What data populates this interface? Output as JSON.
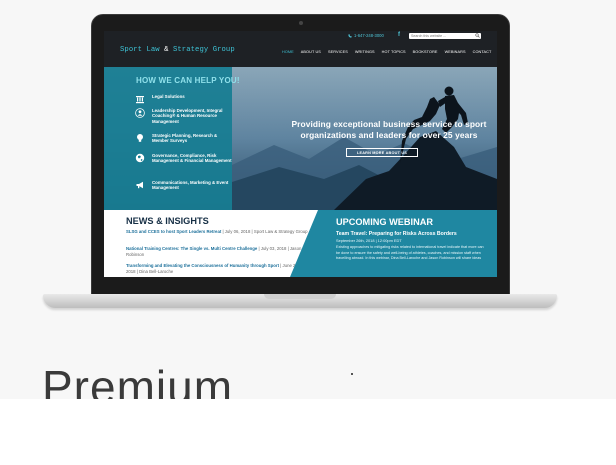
{
  "site": {
    "logo_part1": "Sport Law ",
    "logo_amp": "&",
    "logo_part2": " Strategy Group",
    "phone": "1-647-248-3000",
    "search_placeholder": "Search this website ...",
    "nav": [
      "HOME",
      "ABOUT US",
      "SERVICES",
      "WRITINGS",
      "HOT TOPICS",
      "BOOKSTORE",
      "WEBINARS",
      "CONTACT"
    ]
  },
  "hero": {
    "help_title": "HOW WE CAN HELP YOU!",
    "items": [
      {
        "label": "Legal Solutions",
        "icon": "gavel-icon"
      },
      {
        "label": "Leadership Development, Integral Coaching® & Human Resource Management",
        "icon": "person-icon"
      },
      {
        "label": "Strategic Planning, Research & Member Surveys",
        "icon": "lightbulb-icon"
      },
      {
        "label": "Governance, Compliance, Risk Management & Financial Management",
        "icon": "globe-icon"
      },
      {
        "label": "Communications, Marketing & Event Management",
        "icon": "megaphone-icon"
      }
    ],
    "tagline": "Providing exceptional business service to sport organizations and leaders for over 25 years",
    "cta": "LEARN MORE ABOUT US"
  },
  "news": {
    "title": "NEWS & INSIGHTS",
    "items": [
      {
        "headline": "SLSG and CCES to host Sport Leaders Retreat",
        "meta": " | July 06, 2018 | Sport Law & Strategy Group"
      },
      {
        "headline": "National Training Centres: The Single vs. Multi Centre Challenge",
        "meta": " | July 03, 2018 | Jason Robinson"
      },
      {
        "headline": "Transforming and Elevating the Consciousness of Humanity through Sport",
        "meta": " | June 20, 2018 | Dina Bell-Laroche"
      }
    ]
  },
  "webinar": {
    "title": "UPCOMING WEBINAR",
    "subtitle": "Team Travel: Preparing for Risks Across Borders",
    "date": "September 26th, 2018 | 12:00pm EDT",
    "description": "Existing approaches to mitigating risks related to international travel indicate that more can be done to ensure the safety and well-being of athletes, coaches, and mission staff when travelling abroad. In this webinar, Dina Bell-Laroche and Jason Robinson will share ideas"
  },
  "caption": {
    "heading": "Premium"
  },
  "colors": {
    "teal": "#1f87a1",
    "accent": "#3ec3d6",
    "header_bg": "#1e2125",
    "news_title": "#162f45"
  }
}
